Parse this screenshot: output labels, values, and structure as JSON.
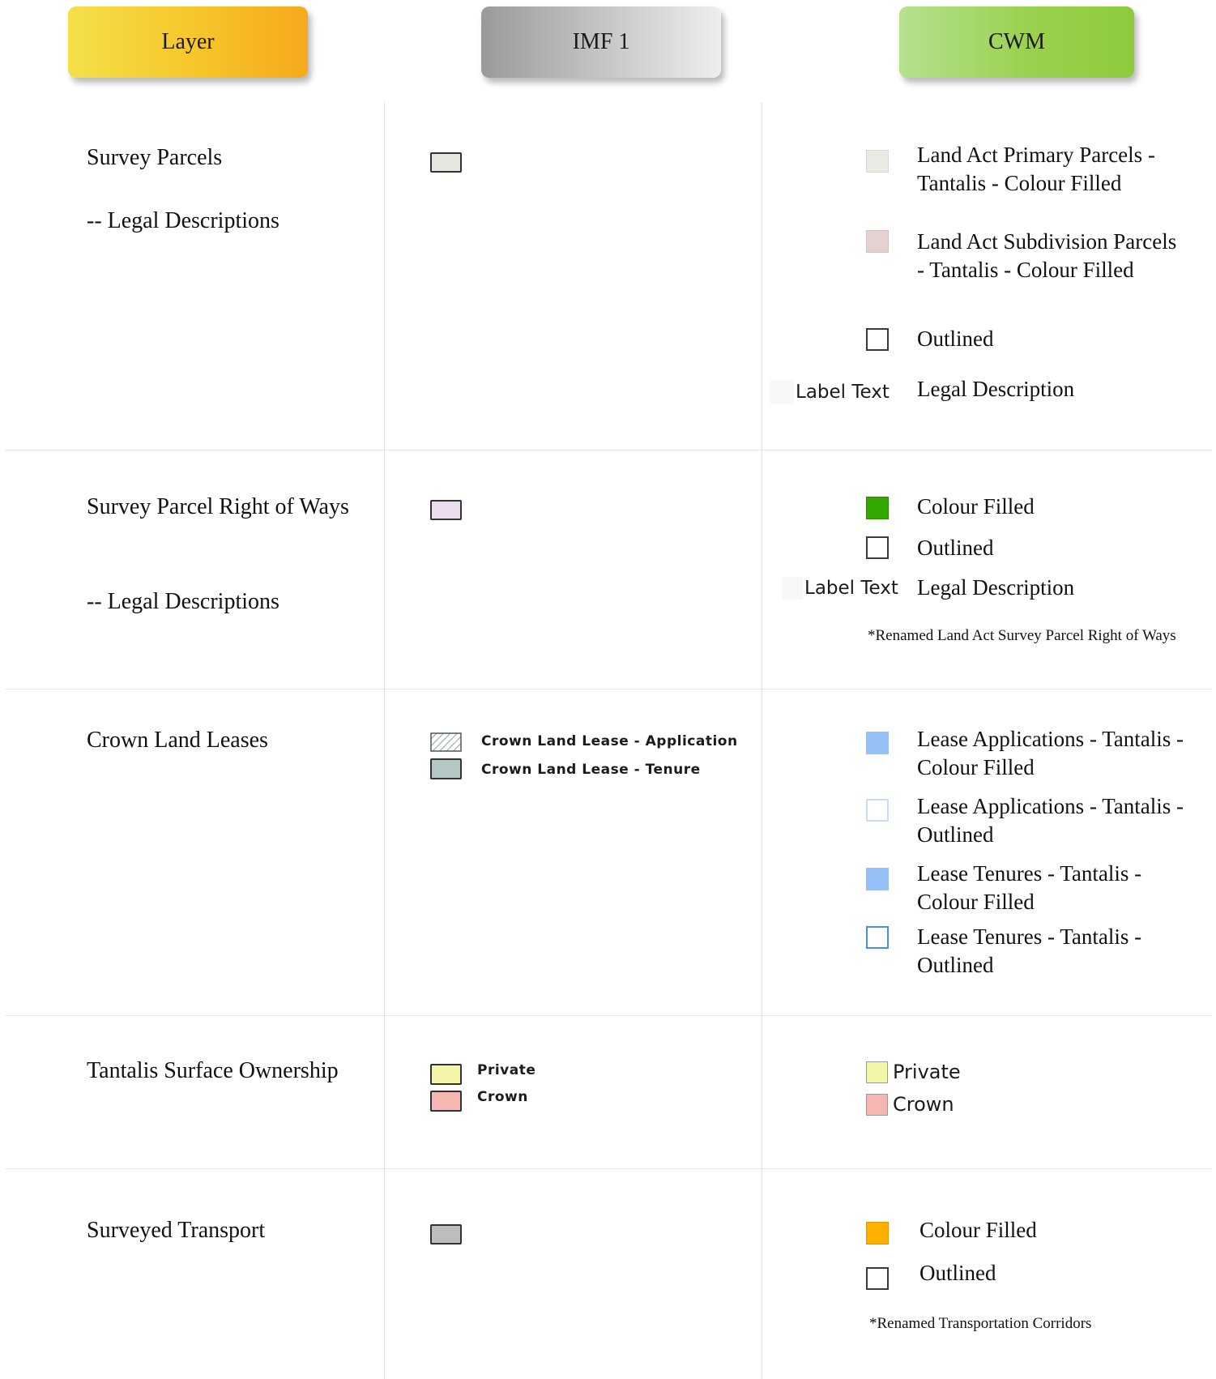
{
  "headers": {
    "layer": "Layer",
    "imf": "IMF 1",
    "cwm": "CWM"
  },
  "rows": {
    "survey_parcels": {
      "layer": "Survey Parcels",
      "sublayer": "-- Legal Descriptions",
      "cwm": {
        "primary": "Land Act Primary Parcels - Tantalis - Colour Filled",
        "subdivision": "Land Act Subdivision Parcels - Tantalis - Colour Filled",
        "outlined": "Outlined",
        "label_sample": "Label Text",
        "legal": "Legal Description"
      }
    },
    "row_of_ways": {
      "layer": "Survey Parcel Right of Ways",
      "sublayer": "-- Legal Descriptions",
      "cwm": {
        "filled": "Colour Filled",
        "outlined": "Outlined",
        "label_sample": "Label Text",
        "legal": "Legal Description",
        "note": "*Renamed Land Act Survey Parcel Right of Ways"
      }
    },
    "crown_leases": {
      "layer": "Crown Land Leases",
      "imf": {
        "application": "Crown Land Lease - Application",
        "tenure": "Crown Land Lease - Tenure"
      },
      "cwm": {
        "app_filled": "Lease Applications - Tantalis - Colour Filled",
        "app_outlined": "Lease Applications - Tantalis - Outlined",
        "ten_filled": "Lease Tenures - Tantalis - Colour Filled",
        "ten_outlined": "Lease Tenures - Tantalis - Outlined"
      }
    },
    "surface_ownership": {
      "layer": "Tantalis Surface Ownership",
      "imf": {
        "private": "Private",
        "crown": "Crown"
      },
      "cwm": {
        "private": "Private",
        "crown": "Crown"
      }
    },
    "surveyed_transport": {
      "layer": "Surveyed Transport",
      "cwm": {
        "filled": "Colour Filled",
        "outlined": "Outlined",
        "note": "*Renamed Transportation Corridors"
      }
    }
  },
  "colors": {
    "parcel_imf": "#e6e6df",
    "parcel_primary": "#ebebe5",
    "parcel_subdivision": "#e3d2cf",
    "row_imf": "#ecdcee",
    "row_filled": "#33a800",
    "lease_tenure_imf": "#b4c7c4",
    "lease_fill": "#97c0f8",
    "lease_outline": "#4a8ee8",
    "private": "#f3f6a8",
    "crown": "#f6b7b2",
    "transport_imf": "#bdbdbd",
    "transport_fill": "#ffaf00"
  }
}
